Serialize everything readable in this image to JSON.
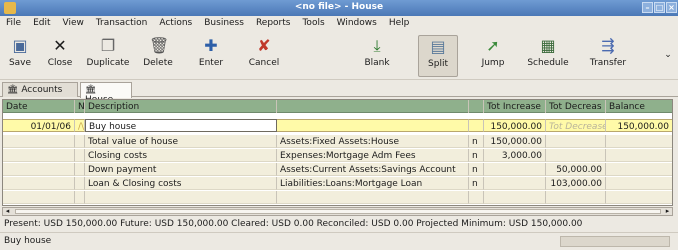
{
  "window": {
    "title": "<no file> - House"
  },
  "menu": [
    "File",
    "Edit",
    "View",
    "Transaction",
    "Actions",
    "Business",
    "Reports",
    "Tools",
    "Windows",
    "Help"
  ],
  "toolbar": {
    "save": "Save",
    "close": "Close",
    "duplicate": "Duplicate",
    "delete": "Delete",
    "enter": "Enter",
    "cancel": "Cancel",
    "blank": "Blank",
    "split": "Split",
    "jump": "Jump",
    "schedule": "Schedule",
    "transfer": "Transfer"
  },
  "tabs": [
    "Accounts",
    "House"
  ],
  "register": {
    "headers": {
      "date": "Date",
      "num": "N",
      "description": "Description",
      "transfer": "",
      "r": "",
      "increase": "Tot Increase",
      "decrease": "Tot Decreas",
      "balance": "Balance"
    },
    "transaction": {
      "date": "01/01/06",
      "num": "/\\",
      "description": "Buy house",
      "transfer": "",
      "r": "",
      "increase": "150,000.00",
      "decrease": "Tot Decrease",
      "balance": "150,000.00"
    },
    "splits": [
      {
        "memo": "Total value of house",
        "account": "Assets:Fixed Assets:House",
        "r": "n",
        "increase": "150,000.00",
        "decrease": ""
      },
      {
        "memo": "Closing costs",
        "account": "Expenses:Mortgage Adm Fees",
        "r": "n",
        "increase": "3,000.00",
        "decrease": ""
      },
      {
        "memo": "Down payment",
        "account": "Assets:Current Assets:Savings Account",
        "r": "n",
        "increase": "",
        "decrease": "50,000.00"
      },
      {
        "memo": "Loan & Closing costs",
        "account": "Liabilities:Loans:Mortgage Loan",
        "r": "n",
        "increase": "",
        "decrease": "103,000.00"
      }
    ]
  },
  "summary": "Present: USD 150,000.00    Future: USD 150,000.00    Cleared: USD 0.00    Reconciled: USD 0.00    Projected Minimum: USD 150,000.00",
  "status": "Buy house"
}
